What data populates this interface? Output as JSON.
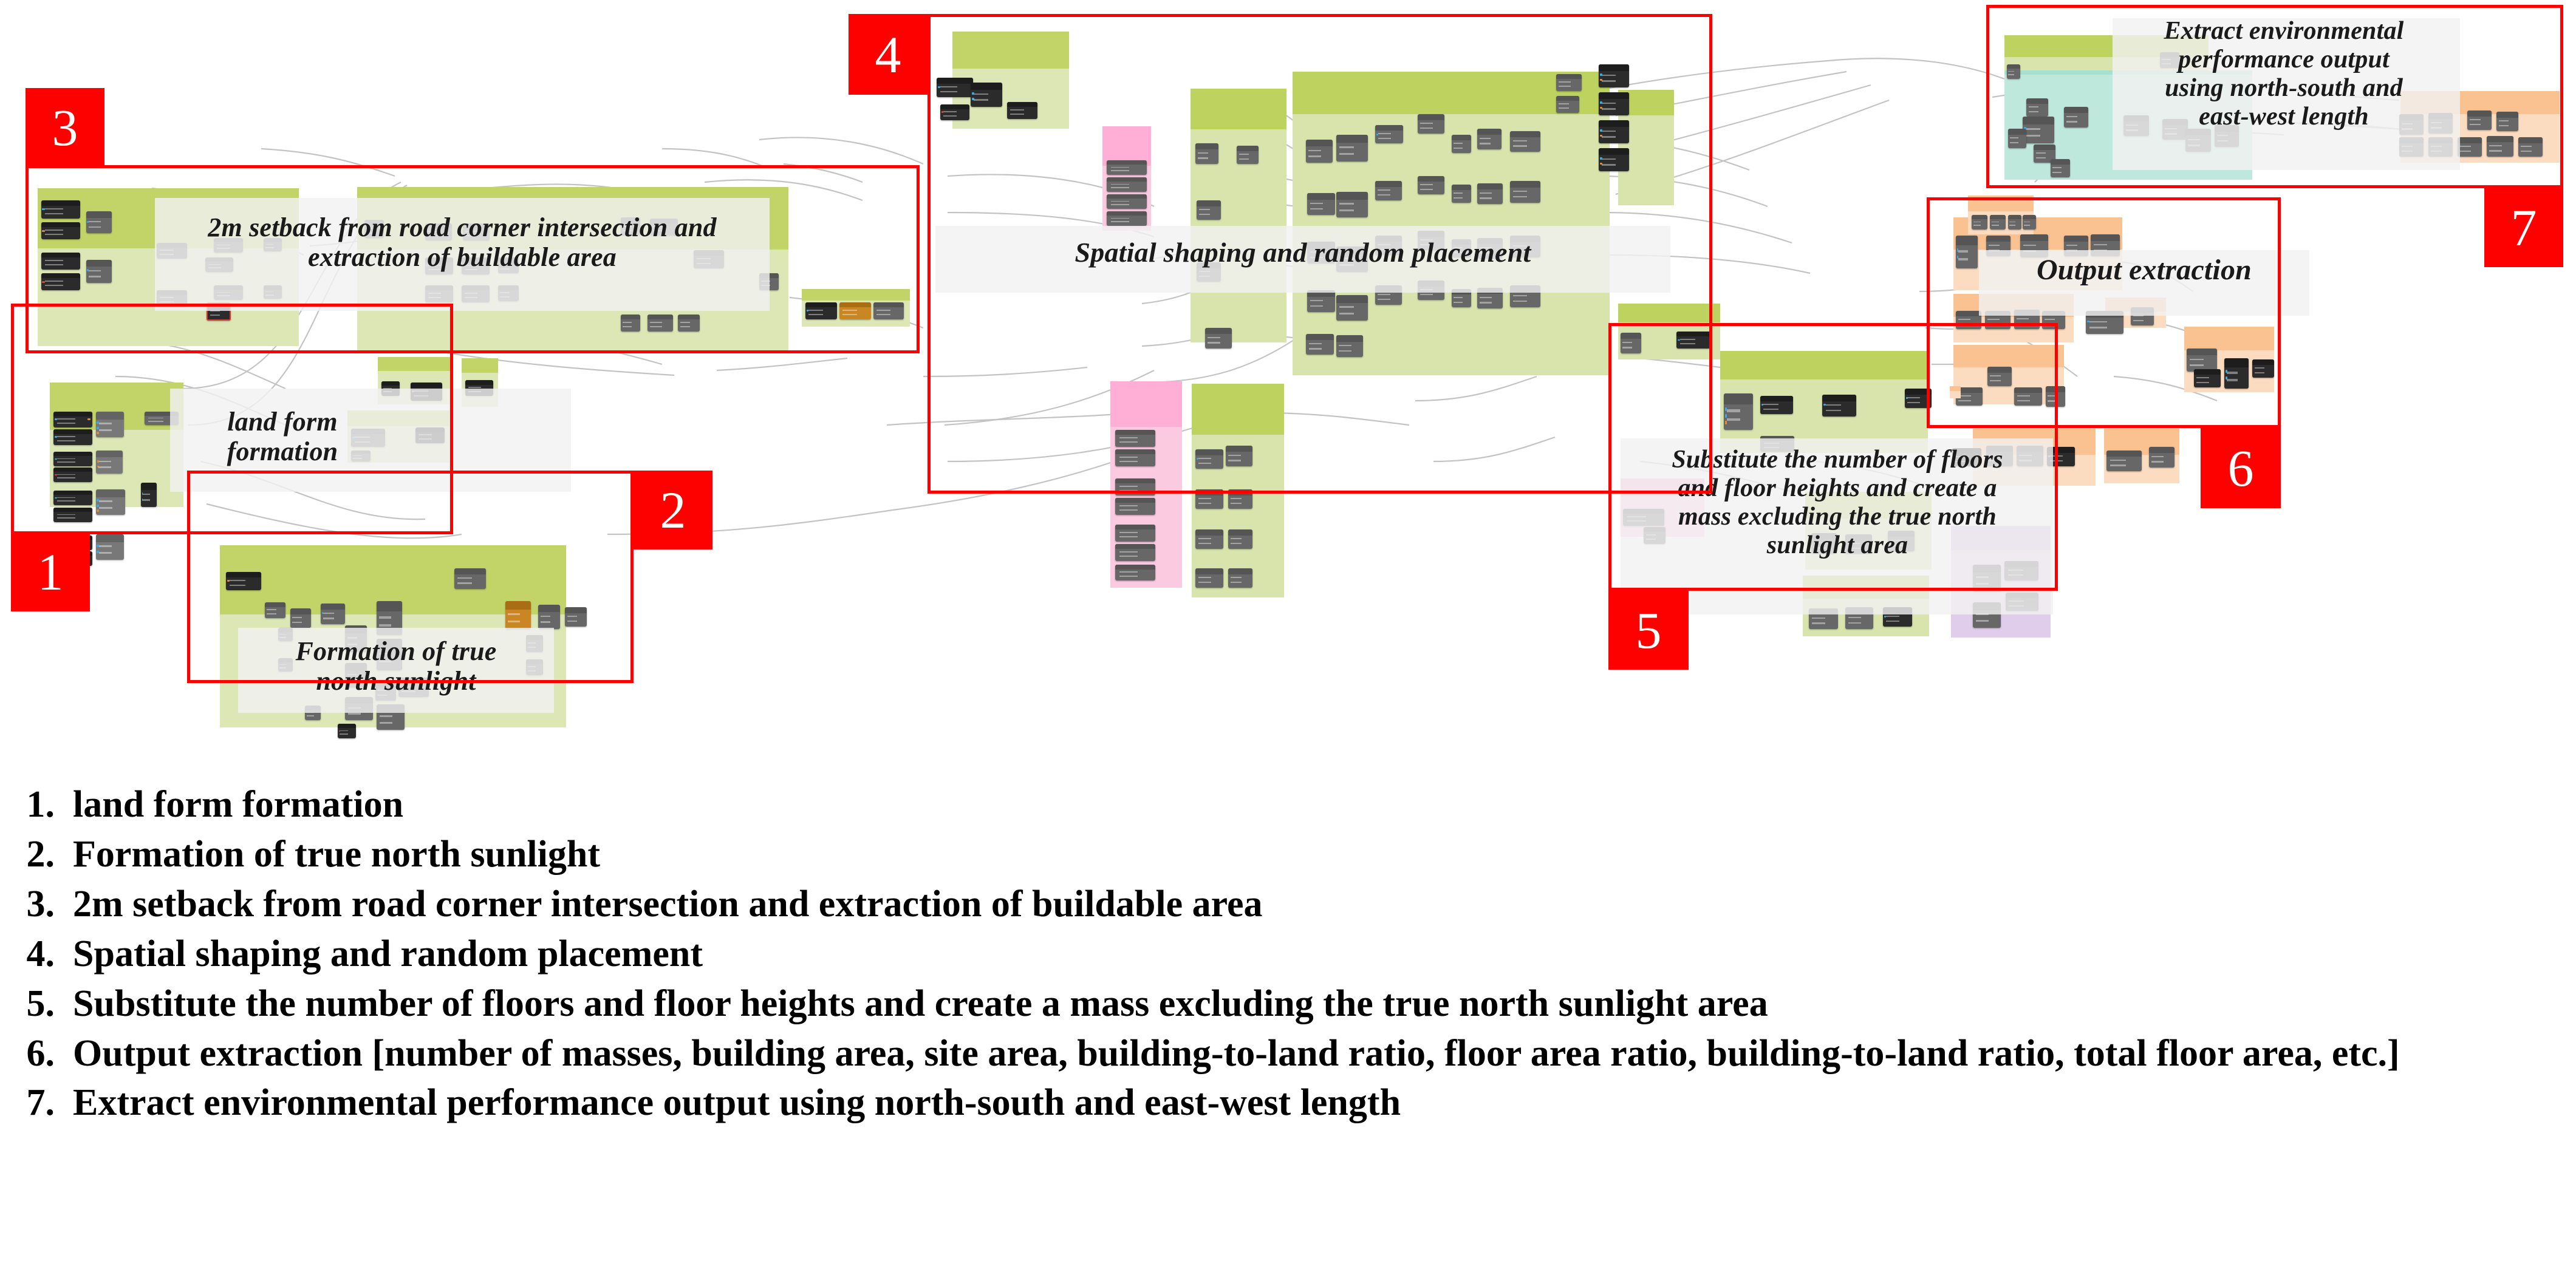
{
  "document": {
    "type": "visual-programming-script-annotated-diagram",
    "accent_red": "#fd0000",
    "group_colors": {
      "green": "#c2d468",
      "green_fill": "#dde6b5",
      "pink": "#ffaed5",
      "pink_fill": "#fbc9e0",
      "orange": "#fac191",
      "orange_fill": "#fbdcc0",
      "teal": "#a8e0cf",
      "teal_fill": "#bfe8dc",
      "purple": "#d3b8e3",
      "purple_fill": "#e0cdeb",
      "grey_plate": "#f2f2f2"
    }
  },
  "annotations": [
    {
      "id": "1",
      "tag": "1",
      "caption": "land form\nformation"
    },
    {
      "id": "2",
      "tag": "2",
      "caption": "Formation of true\nnorth sunlight"
    },
    {
      "id": "3",
      "tag": "3",
      "caption": "2m setback from road corner intersection and\nextraction of buildable area"
    },
    {
      "id": "4",
      "tag": "4",
      "caption": "Spatial shaping and random placement"
    },
    {
      "id": "5",
      "tag": "5",
      "caption": "Substitute the number of floors\nand floor heights and create a\nmass excluding the true north\nsunlight area"
    },
    {
      "id": "6",
      "tag": "6",
      "caption": "Output extraction"
    },
    {
      "id": "7",
      "tag": "7",
      "caption": "Extract environmental\nperformance output\nusing north-south and\neast-west length"
    }
  ],
  "captions": {
    "c1": "land form formation",
    "c1_l1": "land form",
    "c1_l2": "formation",
    "c2_l1": "Formation of true",
    "c2_l2": "north sunlight",
    "c3_l1": "2m setback from road corner intersection and",
    "c3_l2": "extraction of buildable area",
    "c4": "Spatial shaping and random placement",
    "c5_l1": "Substitute the number of floors",
    "c5_l2": "and floor heights and create a",
    "c5_l3": "mass excluding the true north",
    "c5_l4": "sunlight area",
    "c6": "Output extraction",
    "c7_l1": "Extract environmental",
    "c7_l2": "performance output",
    "c7_l3": "using north-south and",
    "c7_l4": "east-west length"
  },
  "tags": {
    "t1": "1",
    "t2": "2",
    "t3": "3",
    "t4": "4",
    "t5": "5",
    "t6": "6",
    "t7": "7"
  },
  "legend": {
    "items": [
      {
        "num": "1.",
        "text": "land form formation"
      },
      {
        "num": "2.",
        "text": "Formation of true north sunlight"
      },
      {
        "num": "3.",
        "text": "2m setback from road corner intersection and extraction of buildable area"
      },
      {
        "num": "4.",
        "text": "Spatial shaping and random placement"
      },
      {
        "num": "5.",
        "text": "Substitute the number of floors and floor heights and create a mass excluding the true north sunlight area"
      },
      {
        "num": "6.",
        "text": "Output extraction [number of masses, building area, site area, building-to-land ratio, floor area ratio, building-to-land ratio, total floor area, etc.]"
      },
      {
        "num": "7.",
        "text": "Extract environmental performance output using north-south and east-west length"
      }
    ]
  }
}
